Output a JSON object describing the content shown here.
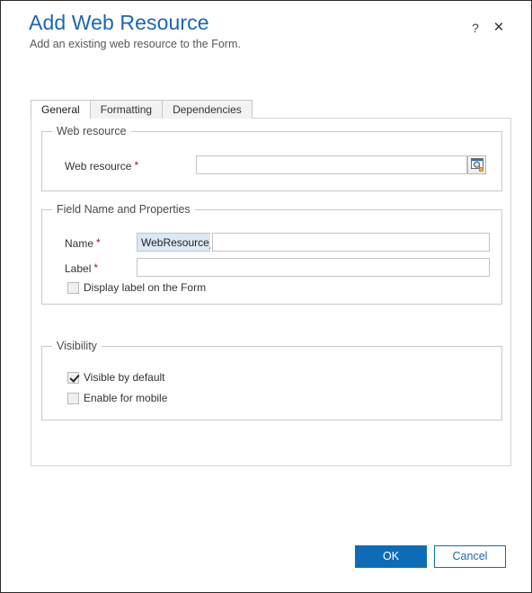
{
  "window": {
    "title": "Add Web Resource",
    "subtitle": "Add an existing web resource to the Form.",
    "help_label": "?",
    "close_label": "✕",
    "accent_color": "#1b66b3",
    "primary_button_color": "#0e6cb6",
    "required_marker": "*",
    "required_marker_color": "#b01010"
  },
  "tabs": [
    {
      "label": "General",
      "active": true
    },
    {
      "label": "Formatting",
      "active": false
    },
    {
      "label": "Dependencies",
      "active": false
    }
  ],
  "sections": {
    "web_resource": {
      "legend": "Web resource",
      "field_label": "Web resource",
      "field_value": "",
      "field_placeholder": "",
      "lookup_icon": "lookup-browse-icon"
    },
    "field_name_and_properties": {
      "legend": "Field Name and Properties",
      "name_label": "Name",
      "name_prefix": "WebResource_",
      "name_value": "",
      "label_label": "Label",
      "label_value": "",
      "display_label_checkbox": {
        "label": "Display label on the Form",
        "checked": false
      }
    },
    "visibility": {
      "legend": "Visibility",
      "visible_by_default": {
        "label": "Visible by default",
        "checked": true
      },
      "enable_for_mobile": {
        "label": "Enable for mobile",
        "checked": false
      }
    }
  },
  "footer": {
    "ok_label": "OK",
    "cancel_label": "Cancel"
  }
}
